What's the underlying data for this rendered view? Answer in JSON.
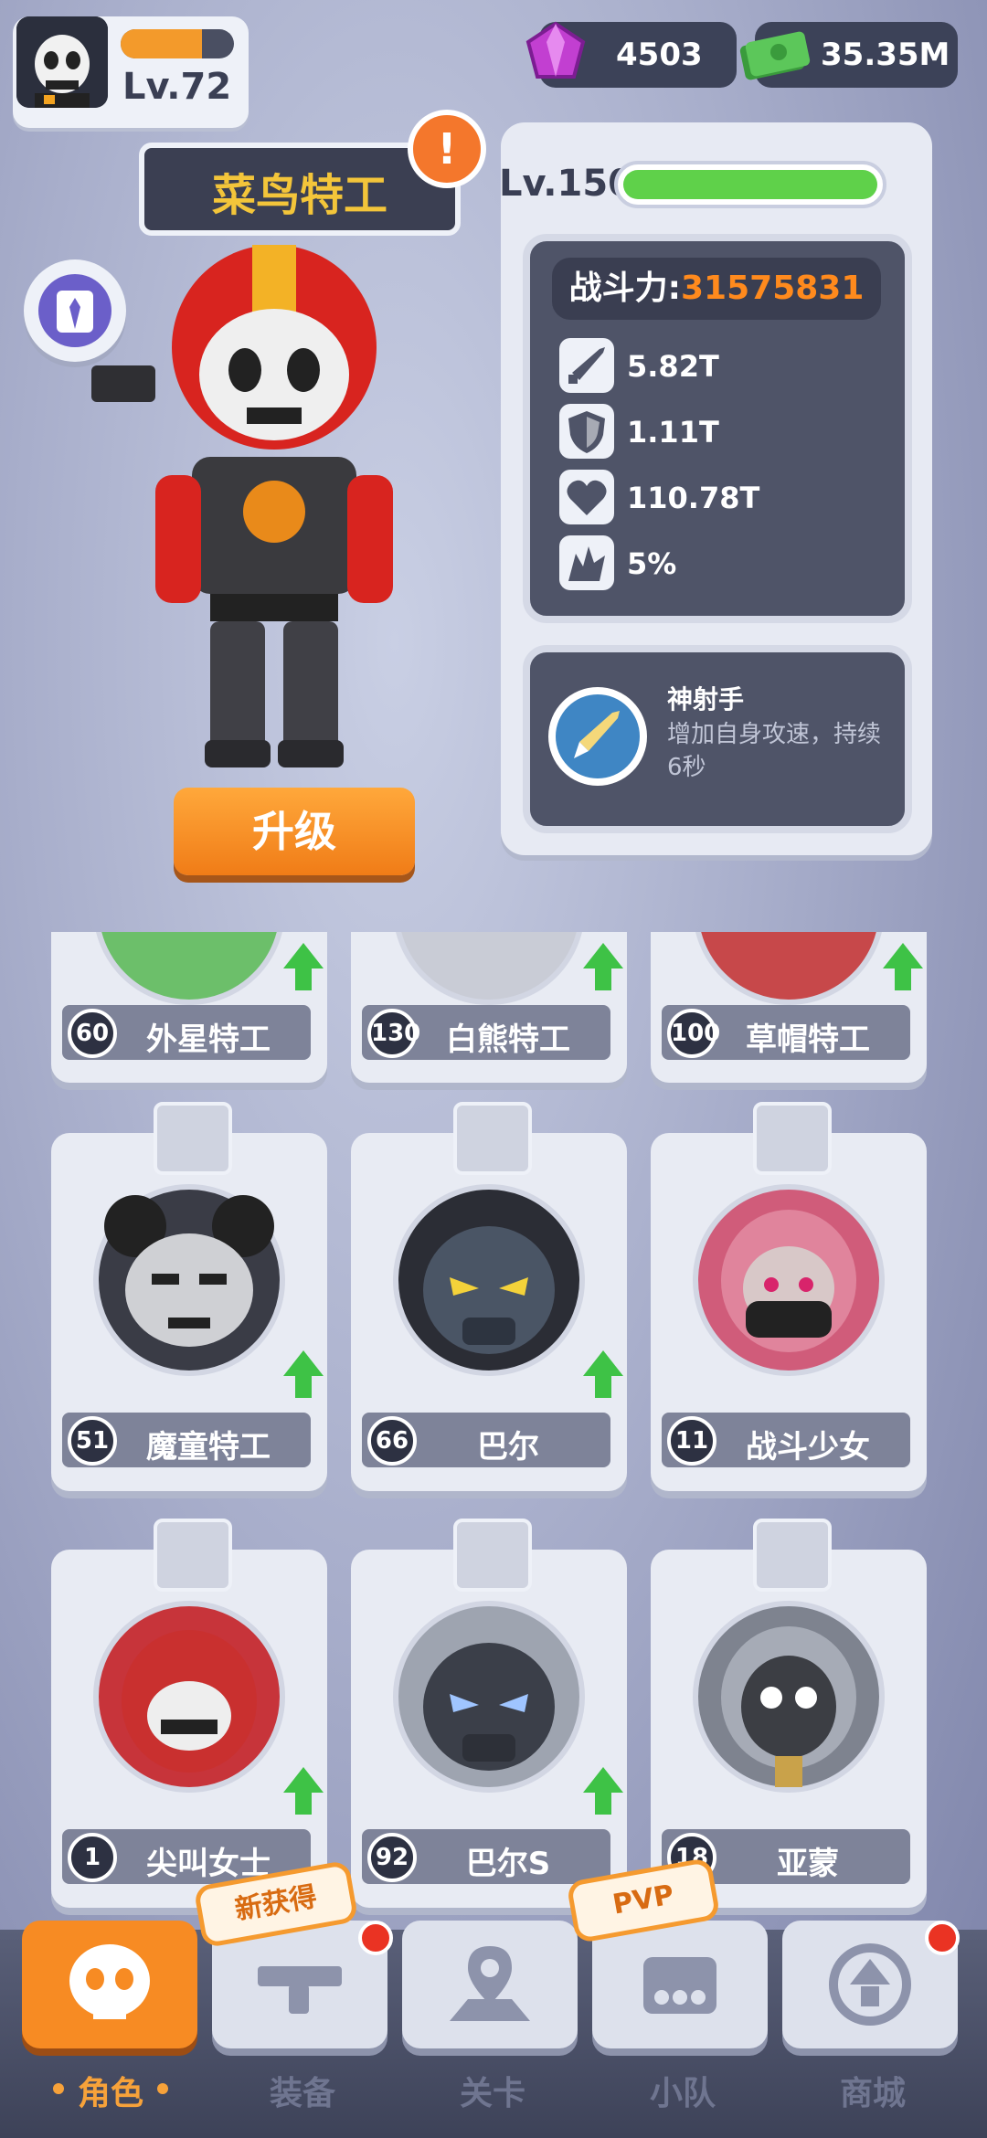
{
  "player": {
    "level": "Lv.72",
    "xp_fraction": 0.72
  },
  "currency": {
    "gems": "4503",
    "cash": "35.35M"
  },
  "hero": {
    "name": "菜鸟特工",
    "alert": "!",
    "level": "Lv.150",
    "hp_fraction": 1.0,
    "power_label": "战斗力:",
    "power_value": "31575831",
    "stats": [
      {
        "icon": "bullet-icon",
        "value": "5.82T"
      },
      {
        "icon": "shield-icon",
        "value": "1.11T"
      },
      {
        "icon": "heart-icon",
        "value": "110.78T"
      },
      {
        "icon": "crit-icon",
        "value": "5%"
      }
    ],
    "skill": {
      "name": "神射手",
      "desc": "增加自身攻速，持续6秒"
    },
    "upgrade_label": "升级"
  },
  "roster": [
    {
      "level": "60",
      "name": "外星特工",
      "upgradeable": true
    },
    {
      "level": "130",
      "name": "白熊特工",
      "upgradeable": true
    },
    {
      "level": "100",
      "name": "草帽特工",
      "upgradeable": true
    },
    {
      "level": "51",
      "name": "魔童特工",
      "upgradeable": true
    },
    {
      "level": "66",
      "name": "巴尔",
      "upgradeable": true
    },
    {
      "level": "11",
      "name": "战斗少女",
      "upgradeable": false
    },
    {
      "level": "1",
      "name": "尖叫女士",
      "upgradeable": true
    },
    {
      "level": "92",
      "name": "巴尔S",
      "upgradeable": true
    },
    {
      "level": "18",
      "name": "亚蒙",
      "upgradeable": false
    }
  ],
  "nav": {
    "items": [
      {
        "label": "角色",
        "active": true
      },
      {
        "label": "装备",
        "active": false
      },
      {
        "label": "关卡",
        "active": false
      },
      {
        "label": "小队",
        "active": false
      },
      {
        "label": "商城",
        "active": false
      }
    ],
    "tags": {
      "new": "新获得",
      "pvp": "PVP"
    }
  }
}
